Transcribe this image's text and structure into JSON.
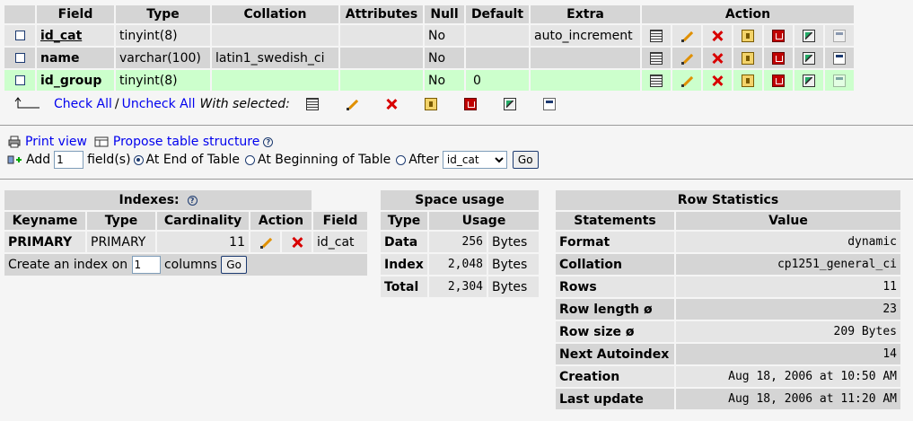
{
  "structure": {
    "headers": [
      "Field",
      "Type",
      "Collation",
      "Attributes",
      "Null",
      "Default",
      "Extra",
      "Action"
    ],
    "rows": [
      {
        "field": "id_cat",
        "type": "tinyint(8)",
        "collation": "",
        "attributes": "",
        "null": "No",
        "default": "",
        "extra": "auto_increment",
        "fulltext_enabled": false
      },
      {
        "field": "name",
        "type": "varchar(100)",
        "collation": "latin1_swedish_ci",
        "attributes": "",
        "null": "No",
        "default": "",
        "extra": "",
        "fulltext_enabled": true
      },
      {
        "field": "id_group",
        "type": "tinyint(8)",
        "collation": "",
        "attributes": "",
        "null": "No",
        "default": "0",
        "extra": "",
        "fulltext_enabled": false
      }
    ],
    "action_icons": [
      "browse-icon",
      "edit-icon",
      "drop-icon",
      "primary-key-icon",
      "unique-icon",
      "index-icon",
      "fulltext-icon"
    ],
    "check_all": "Check All",
    "separator": "/",
    "uncheck_all": "Uncheck All",
    "with_selected": "With selected:"
  },
  "tools": {
    "print_view": "Print view",
    "propose_structure": "Propose table structure",
    "add_label": "Add",
    "add_count": "1",
    "fields_label": "field(s)",
    "at_end": "At End of Table",
    "at_beginning": "At Beginning of Table",
    "after": "After",
    "after_selected": "id_cat",
    "go": "Go"
  },
  "indexes": {
    "title": "Indexes:",
    "headers": [
      "Keyname",
      "Type",
      "Cardinality",
      "Action",
      "Field"
    ],
    "row": {
      "keyname": "PRIMARY",
      "type": "PRIMARY",
      "cardinality": "11",
      "field": "id_cat"
    },
    "create_label": "Create an index on",
    "create_count": "1",
    "columns_label": "columns",
    "go": "Go"
  },
  "space_usage": {
    "title": "Space usage",
    "headers": [
      "Type",
      "Usage"
    ],
    "rows": [
      {
        "type": "Data",
        "value": "256",
        "unit": "Bytes"
      },
      {
        "type": "Index",
        "value": "2,048",
        "unit": "Bytes"
      },
      {
        "type": "Total",
        "value": "2,304",
        "unit": "Bytes"
      }
    ]
  },
  "row_stats": {
    "title": "Row Statistics",
    "headers": [
      "Statements",
      "Value"
    ],
    "rows": [
      {
        "label": "Format",
        "value": "dynamic"
      },
      {
        "label": "Collation",
        "value": "cp1251_general_ci"
      },
      {
        "label": "Rows",
        "value": "11"
      },
      {
        "label": "Row length ø",
        "value": "23"
      },
      {
        "label": "Row size ø",
        "value": "209 Bytes"
      },
      {
        "label": "Next Autoindex",
        "value": "14"
      },
      {
        "label": "Creation",
        "value": "Aug 18, 2006 at 10:50 AM"
      },
      {
        "label": "Last update",
        "value": "Aug 18, 2006 at 11:20 AM"
      }
    ]
  },
  "colors": {
    "page_bg": "#f5f5f5",
    "header_bg": "#d5d5d5",
    "row_odd": "#e5e5e5",
    "row_marked": "#ccffcc",
    "link": "#0000ee"
  }
}
